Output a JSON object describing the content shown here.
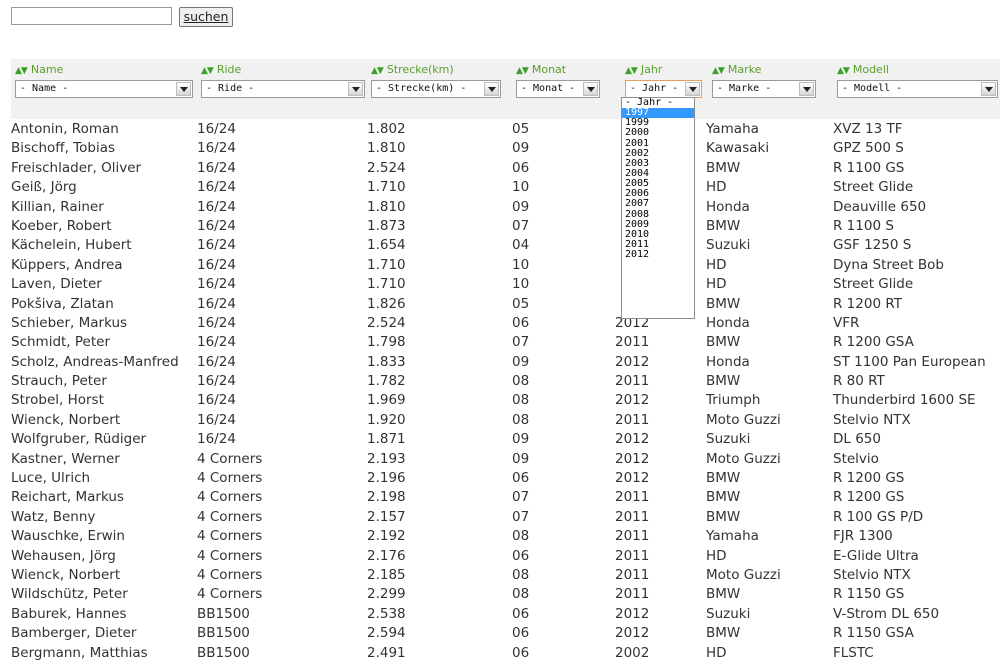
{
  "search": {
    "value": "",
    "button_label": "suchen"
  },
  "columns": [
    {
      "key": "name",
      "label": "Name",
      "filter": "- Name -"
    },
    {
      "key": "ride",
      "label": "Ride",
      "filter": "- Ride -"
    },
    {
      "key": "strecke",
      "label": "Strecke(km)",
      "filter": "- Strecke(km) -"
    },
    {
      "key": "monat",
      "label": "Monat",
      "filter": "- Monat -"
    },
    {
      "key": "jahr",
      "label": "Jahr",
      "filter": "- Jahr -"
    },
    {
      "key": "marke",
      "label": "Marke",
      "filter": "- Marke -"
    },
    {
      "key": "modell",
      "label": "Modell",
      "filter": "- Modell -"
    }
  ],
  "sort_arrows": "▲▼",
  "year_dropdown": {
    "options": [
      "- Jahr -",
      "1997",
      "1999",
      "2000",
      "2001",
      "2002",
      "2003",
      "2004",
      "2005",
      "2006",
      "2007",
      "2008",
      "2009",
      "2010",
      "2011",
      "2012"
    ],
    "selected_index": 1
  },
  "rows": [
    [
      "Antonin, Roman",
      "16/24",
      "1.802",
      "05",
      "",
      "Yamaha",
      "XVZ 13 TF"
    ],
    [
      "Bischoff, Tobias",
      "16/24",
      "1.810",
      "09",
      "",
      "Kawasaki",
      "GPZ 500 S"
    ],
    [
      "Freischlader, Oliver",
      "16/24",
      "2.524",
      "06",
      "",
      "BMW",
      "R 1100 GS"
    ],
    [
      "Geiß, Jörg",
      "16/24",
      "1.710",
      "10",
      "",
      "HD",
      "Street Glide"
    ],
    [
      "Killian, Rainer",
      "16/24",
      "1.810",
      "09",
      "",
      "Honda",
      "Deauville 650"
    ],
    [
      "Koeber, Robert",
      "16/24",
      "1.873",
      "07",
      "",
      "BMW",
      "R 1100 S"
    ],
    [
      "Kächelein, Hubert",
      "16/24",
      "1.654",
      "04",
      "",
      "Suzuki",
      "GSF 1250 S"
    ],
    [
      "Küppers, Andrea",
      "16/24",
      "1.710",
      "10",
      "",
      "HD",
      "Dyna Street Bob"
    ],
    [
      "Laven, Dieter",
      "16/24",
      "1.710",
      "10",
      "",
      "HD",
      "Street Glide"
    ],
    [
      "Pokšiva, Zlatan",
      "16/24",
      "1.826",
      "05",
      "",
      "BMW",
      "R 1200 RT"
    ],
    [
      "Schieber, Markus",
      "16/24",
      "2.524",
      "06",
      "2012",
      "Honda",
      "VFR"
    ],
    [
      "Schmidt, Peter",
      "16/24",
      "1.798",
      "07",
      "2011",
      "BMW",
      "R 1200 GSA"
    ],
    [
      "Scholz, Andreas-Manfred",
      "16/24",
      "1.833",
      "09",
      "2012",
      "Honda",
      "ST 1100 Pan European"
    ],
    [
      "Strauch, Peter",
      "16/24",
      "1.782",
      "08",
      "2011",
      "BMW",
      "R 80 RT"
    ],
    [
      "Strobel, Horst",
      "16/24",
      "1.969",
      "08",
      "2012",
      "Triumph",
      "Thunderbird 1600 SE"
    ],
    [
      "Wienck, Norbert",
      "16/24",
      "1.920",
      "08",
      "2011",
      "Moto Guzzi",
      "Stelvio NTX"
    ],
    [
      "Wolfgruber, Rüdiger",
      "16/24",
      "1.871",
      "09",
      "2012",
      "Suzuki",
      "DL 650"
    ],
    [
      "Kastner, Werner",
      "4 Corners",
      "2.193",
      "09",
      "2012",
      "Moto Guzzi",
      "Stelvio"
    ],
    [
      "Luce, Ulrich",
      "4 Corners",
      "2.196",
      "06",
      "2012",
      "BMW",
      "R 1200 GS"
    ],
    [
      "Reichart, Markus",
      "4 Corners",
      "2.198",
      "07",
      "2011",
      "BMW",
      "R 1200 GS"
    ],
    [
      "Watz, Benny",
      "4 Corners",
      "2.157",
      "07",
      "2011",
      "BMW",
      "R 100 GS P/D"
    ],
    [
      "Wauschke, Erwin",
      "4 Corners",
      "2.192",
      "08",
      "2011",
      "Yamaha",
      "FJR 1300"
    ],
    [
      "Wehausen, Jörg",
      "4 Corners",
      "2.176",
      "06",
      "2011",
      "HD",
      "E-Glide Ultra"
    ],
    [
      "Wienck, Norbert",
      "4 Corners",
      "2.185",
      "08",
      "2011",
      "Moto Guzzi",
      "Stelvio NTX"
    ],
    [
      "Wildschütz, Peter",
      "4 Corners",
      "2.299",
      "08",
      "2011",
      "BMW",
      "R 1150 GS"
    ],
    [
      "Baburek, Hannes",
      "BB1500",
      "2.538",
      "06",
      "2012",
      "Suzuki",
      "V-Strom DL 650"
    ],
    [
      "Bamberger, Dieter",
      "BB1500",
      "2.594",
      "06",
      "2012",
      "BMW",
      "R 1150 GSA"
    ],
    [
      "Bergmann, Matthias",
      "BB1500",
      "2.491",
      "06",
      "2002",
      "HD",
      "FLSTC"
    ]
  ]
}
